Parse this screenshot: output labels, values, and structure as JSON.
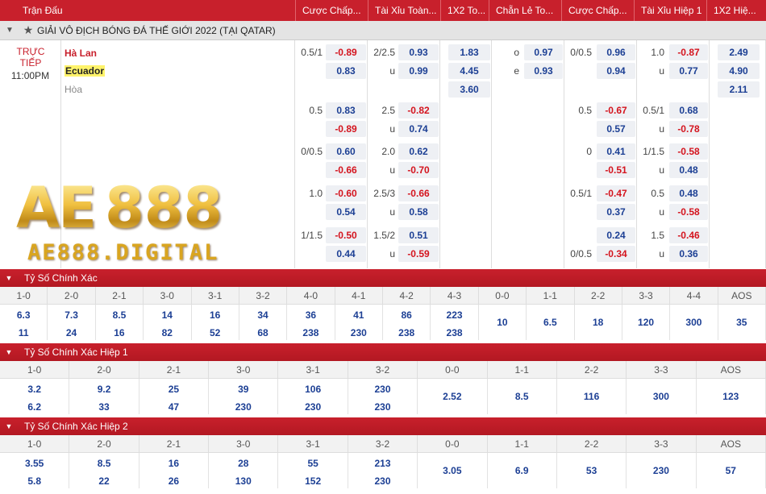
{
  "header": [
    "Trận Đấu",
    "Cược Chấp...",
    "Tài Xỉu Toàn...",
    "1X2 To...",
    "Chẵn Lẻ To...",
    "Cược Chấp...",
    "Tài Xỉu Hiệp 1",
    "1X2 Hiệ..."
  ],
  "league": {
    "name": "GIẢI VÔ ĐỊCH BÓNG ĐÁ THẾ GIỚI 2022 (TẠI QATAR)"
  },
  "match": {
    "status": "TRỰC TIẾP",
    "time": "11:00PM",
    "home": "Hà Lan",
    "away": "Ecuador",
    "draw": "Hòa"
  },
  "watermark": {
    "big": "AE",
    "big2": "888",
    "sub": "AE888.DIGITAL"
  },
  "odds_rows": [
    {
      "hcap_line": "0.5/1",
      "hcap": [
        "-0.89",
        "0.83"
      ],
      "ou_line": "2/2.5",
      "ou": [
        "0.93",
        "0.99"
      ],
      "ou_lbl": [
        "",
        "u"
      ],
      "x12": [
        "1.83",
        "4.45",
        "3.60"
      ],
      "oe": [
        "0.97",
        "0.93"
      ],
      "oe_lbl": [
        "o",
        "e"
      ],
      "h1_line": "0/0.5",
      "h1": [
        "0.96",
        "0.94"
      ],
      "ou1_line": "1.0",
      "ou1": [
        "-0.87",
        "0.77"
      ],
      "x121": [
        "2.49",
        "4.90",
        "2.11"
      ]
    },
    {
      "hcap_line": "0.5",
      "hcap": [
        "0.83",
        "-0.89"
      ],
      "ou_line": "2.5",
      "ou": [
        "-0.82",
        "0.74"
      ],
      "h1_line": "0.5",
      "h1": [
        "-0.67",
        "0.57"
      ],
      "ou1_line": "0.5/1",
      "ou1": [
        "0.68",
        "-0.78"
      ]
    },
    {
      "hcap_line": "0/0.5",
      "hcap": [
        "0.60",
        "-0.66"
      ],
      "ou_line": "2.0",
      "ou": [
        "0.62",
        "-0.70"
      ],
      "h1_line": "0",
      "h1": [
        "0.41",
        "-0.51"
      ],
      "ou1_line": "1/1.5",
      "ou1": [
        "-0.58",
        "0.48"
      ]
    },
    {
      "hcap_line": "1.0",
      "hcap": [
        "-0.60",
        "0.54"
      ],
      "ou_line": "2.5/3",
      "ou": [
        "-0.66",
        "0.58"
      ],
      "h1_line": "0.5/1",
      "h1": [
        "-0.47",
        "0.37"
      ],
      "ou1_line": "0.5",
      "ou1": [
        "0.48",
        "-0.58"
      ]
    },
    {
      "hcap_line": "1/1.5",
      "hcap": [
        "-0.50",
        "0.44"
      ],
      "ou_line": "1.5/2",
      "ou": [
        "0.51",
        "-0.59"
      ],
      "h1_line": "0/0.5",
      "h1_line_pos": "bottom",
      "h1": [
        "0.24",
        "-0.34"
      ],
      "ou1_line": "1.5",
      "ou1": [
        "-0.46",
        "0.36"
      ]
    }
  ],
  "cs_full": {
    "title": "Tỷ Số Chính Xác",
    "headers": [
      "1-0",
      "2-0",
      "2-1",
      "3-0",
      "3-1",
      "3-2",
      "4-0",
      "4-1",
      "4-2",
      "4-3",
      "0-0",
      "1-1",
      "2-2",
      "3-3",
      "4-4",
      "AOS"
    ],
    "top": [
      "6.3",
      "7.3",
      "8.5",
      "14",
      "16",
      "34",
      "36",
      "41",
      "86",
      "223"
    ],
    "bottom": [
      "11",
      "24",
      "16",
      "82",
      "52",
      "68",
      "238",
      "230",
      "238",
      "238"
    ],
    "single": [
      "10",
      "6.5",
      "18",
      "120",
      "300",
      "35"
    ]
  },
  "cs_h1": {
    "title": "Tỷ Số Chính Xác Hiệp 1",
    "headers": [
      "1-0",
      "2-0",
      "2-1",
      "3-0",
      "3-1",
      "3-2",
      "0-0",
      "1-1",
      "2-2",
      "3-3",
      "AOS"
    ],
    "top": [
      "3.2",
      "9.2",
      "25",
      "39",
      "106",
      "230"
    ],
    "bottom": [
      "6.2",
      "33",
      "47",
      "230",
      "230",
      "230"
    ],
    "single": [
      "2.52",
      "8.5",
      "116",
      "300",
      "123"
    ]
  },
  "cs_h2": {
    "title": "Tỷ Số Chính Xác Hiệp 2",
    "headers": [
      "1-0",
      "2-0",
      "2-1",
      "3-0",
      "3-1",
      "3-2",
      "0-0",
      "1-1",
      "2-2",
      "3-3",
      "AOS"
    ],
    "top": [
      "3.55",
      "8.5",
      "16",
      "28",
      "55",
      "213"
    ],
    "bottom": [
      "5.8",
      "22",
      "26",
      "130",
      "152",
      "230"
    ],
    "single": [
      "3.05",
      "6.9",
      "53",
      "230",
      "57"
    ]
  }
}
